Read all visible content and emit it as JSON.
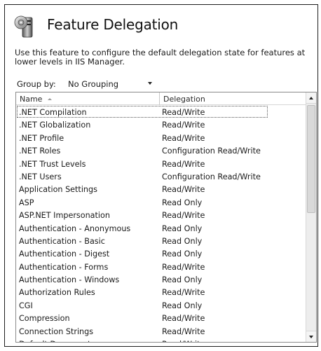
{
  "page": {
    "title": "Feature Delegation",
    "description": "Use this feature to configure the default delegation state for features at lower levels in IIS Manager."
  },
  "group_by": {
    "label": "Group by:",
    "value": "No Grouping"
  },
  "list": {
    "columns": {
      "name": "Name",
      "delegation": "Delegation"
    },
    "sort": "Name ascending",
    "selected_index": 0,
    "rows": [
      {
        "name": ".NET Compilation",
        "delegation": "Read/Write"
      },
      {
        "name": ".NET Globalization",
        "delegation": "Read/Write"
      },
      {
        "name": ".NET Profile",
        "delegation": "Read/Write"
      },
      {
        "name": ".NET Roles",
        "delegation": "Configuration Read/Write"
      },
      {
        "name": ".NET Trust Levels",
        "delegation": "Read/Write"
      },
      {
        "name": ".NET Users",
        "delegation": "Configuration Read/Write"
      },
      {
        "name": "Application Settings",
        "delegation": "Read/Write"
      },
      {
        "name": "ASP",
        "delegation": "Read Only"
      },
      {
        "name": "ASP.NET Impersonation",
        "delegation": "Read/Write"
      },
      {
        "name": "Authentication - Anonymous",
        "delegation": "Read Only"
      },
      {
        "name": "Authentication - Basic",
        "delegation": "Read Only"
      },
      {
        "name": "Authentication - Digest",
        "delegation": "Read Only"
      },
      {
        "name": "Authentication - Forms",
        "delegation": "Read/Write"
      },
      {
        "name": "Authentication - Windows",
        "delegation": "Read Only"
      },
      {
        "name": "Authorization Rules",
        "delegation": "Read/Write"
      },
      {
        "name": "CGI",
        "delegation": "Read Only"
      },
      {
        "name": "Compression",
        "delegation": "Read/Write"
      },
      {
        "name": "Connection Strings",
        "delegation": "Read/Write"
      },
      {
        "name": "Default Document",
        "delegation": "Read/Write"
      }
    ]
  },
  "icons": {
    "header": "server-features-icon",
    "sort": "sort-ascending-icon",
    "dropdown": "chevron-down-icon"
  }
}
